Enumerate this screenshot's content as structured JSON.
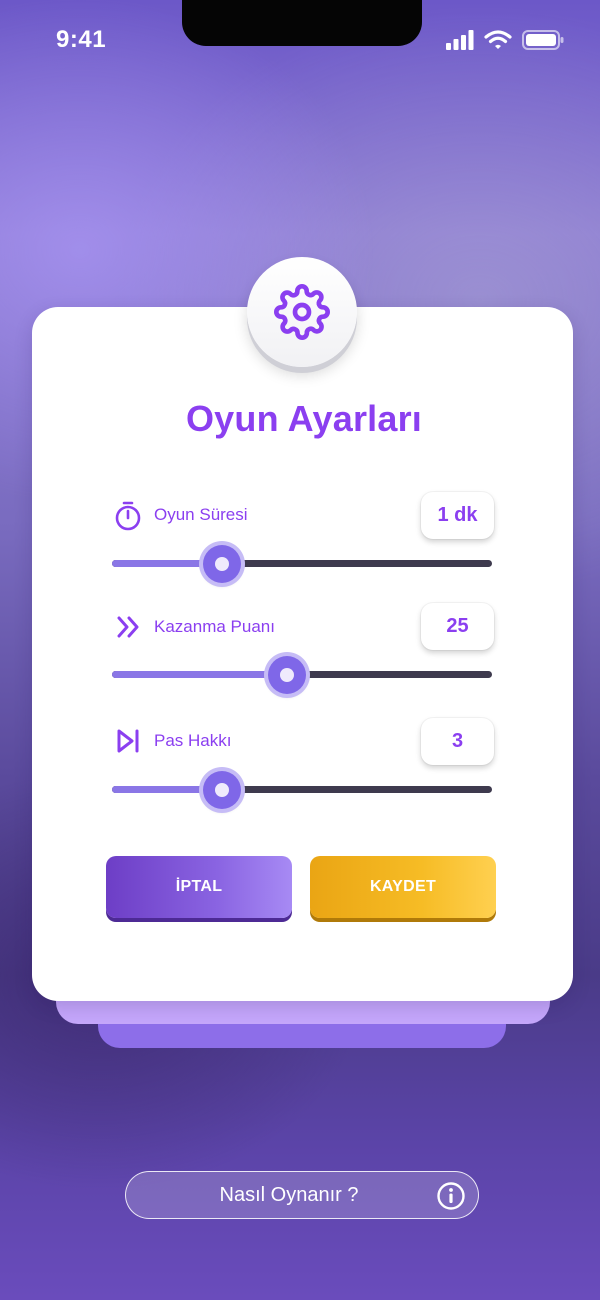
{
  "status_bar": {
    "time": "9:41",
    "icons": [
      "signal-icon",
      "wifi-icon",
      "battery-icon"
    ]
  },
  "settings": {
    "title": "Oyun Ayarları",
    "header_icon": "gear-icon",
    "rows": [
      {
        "icon": "stopwatch-icon",
        "label": "Oyun Süresi",
        "value": "1 dk",
        "slider_fraction": 0.29
      },
      {
        "icon": "double-chevron-right-icon",
        "label": "Kazanma Puanı",
        "value": "25",
        "slider_fraction": 0.46
      },
      {
        "icon": "skip-next-icon",
        "label": "Pas Hakkı",
        "value": "3",
        "slider_fraction": 0.29
      }
    ],
    "buttons": {
      "cancel": "İPTAL",
      "save": "KAYDET"
    }
  },
  "help": {
    "label": "Nasıl Oynanır ?",
    "icon": "info-icon"
  },
  "colors": {
    "accent": "#8b3ff0",
    "cancel_button": "#7a4fd6",
    "save_button": "#f2b31f",
    "slider_fill": "#8a76e6",
    "slider_track": "#3e3a4e"
  }
}
